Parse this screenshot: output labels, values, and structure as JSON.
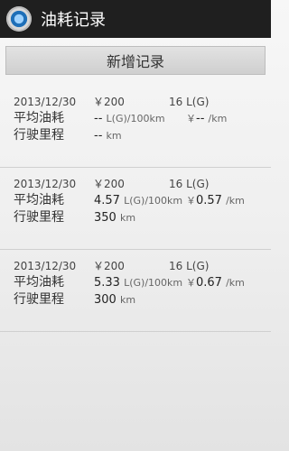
{
  "app": {
    "title": "油耗记录"
  },
  "add_button": "新增记录",
  "records": [
    {
      "date": "2013/12/30",
      "cost": "￥200",
      "fuel": "16 L(G)",
      "avg_label": "平均油耗",
      "avg_value": "--",
      "avg_unit": "L(G)/100km",
      "price_currency": "￥",
      "price_value": "--",
      "price_unit": "/km",
      "dist_label": "行驶里程",
      "dist_value": "--",
      "dist_unit": "km"
    },
    {
      "date": "2013/12/30",
      "cost": "￥200",
      "fuel": "16 L(G)",
      "avg_label": "平均油耗",
      "avg_value": "4.57",
      "avg_unit": "L(G)/100km",
      "price_currency": "￥",
      "price_value": "0.57",
      "price_unit": "/km",
      "dist_label": "行驶里程",
      "dist_value": "350",
      "dist_unit": "km"
    },
    {
      "date": "2013/12/30",
      "cost": "￥200",
      "fuel": "16 L(G)",
      "avg_label": "平均油耗",
      "avg_value": "5.33",
      "avg_unit": "L(G)/100km",
      "price_currency": "￥",
      "price_value": "0.67",
      "price_unit": "/km",
      "dist_label": "行驶里程",
      "dist_value": "300",
      "dist_unit": "km"
    }
  ]
}
